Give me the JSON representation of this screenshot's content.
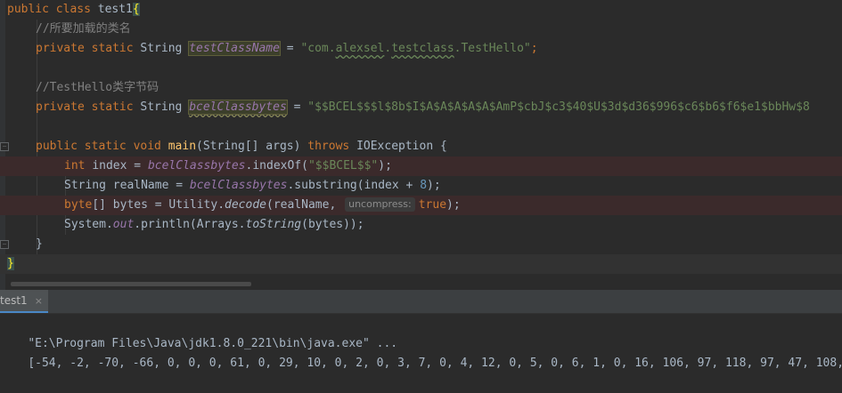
{
  "editor": {
    "lines": {
      "l1": {
        "kw1": "public class ",
        "name": "test1",
        "brace": "{"
      },
      "l2": {
        "comment": "//所要加载的类名"
      },
      "l3": {
        "kw": "private static ",
        "type": "String ",
        "field": "testClassName",
        "eq": " = ",
        "str_q1": "\"com.",
        "str_w1": "alexsel",
        "str_d1": ".",
        "str_w2": "testclass",
        "str_rest": ".TestHello\"",
        "semi": ";"
      },
      "l5": {
        "comment": "//TestHello类字节码"
      },
      "l6": {
        "kw": "private static ",
        "type": "String ",
        "field": "bcelClassbytes",
        "eq": " = ",
        "str": "\"$$BCEL$$$l$8b$I$A$A$A$A$A$AmP$cbJ$c3$40$U$3d$d36$996$c6$b6$f6$e1$bbHw$8"
      },
      "l8": {
        "kw1": "public static ",
        "kw2": "void ",
        "mth": "main",
        "p1": "(String[] args) ",
        "kw3": "throws ",
        "exc": "IOException {"
      },
      "l9": {
        "kw": "int ",
        "var": "index = ",
        "field": "bcelClassbytes",
        "call": ".indexOf(",
        "str": "\"$$BCEL$$\"",
        "end": ");"
      },
      "l10": {
        "t": "String realName = ",
        "field": "bcelClassbytes",
        "call": ".substring(index + ",
        "num": "8",
        "end": ");"
      },
      "l11": {
        "kw": "byte",
        "t1": "[] bytes = Utility.",
        "mth": "decode",
        "t2": "(realName, ",
        "hint": "uncompress:",
        "kw2": "true",
        "end": ");"
      },
      "l12": {
        "t1": "System.",
        "fld": "out",
        "t2": ".println(Arrays.",
        "mth": "toString",
        "t3": "(bytes));"
      },
      "l13": {
        "brace": "}"
      },
      "l14": {
        "brace": "}"
      }
    }
  },
  "tool_window": {
    "tab_label": "test1",
    "tab_close": "×"
  },
  "console": {
    "command": "\"E:\\Program Files\\Java\\jdk1.8.0_221\\bin\\java.exe\" ...",
    "output": "[-54, -2, -70, -66, 0, 0, 0, 61, 0, 29, 10, 0, 2, 0, 3, 7, 0, 4, 12, 0, 5, 0, 6, 1, 0, 16, 106, 97, 118, 97, 47, 108,"
  },
  "colors": {
    "background": "#2b2b2b",
    "keyword": "#cc7832",
    "string": "#6a8759",
    "comment": "#808080",
    "field": "#9876aa",
    "method": "#ffc66d",
    "error_line": "#3b2a2b",
    "tab_accent": "#4a88c7"
  }
}
